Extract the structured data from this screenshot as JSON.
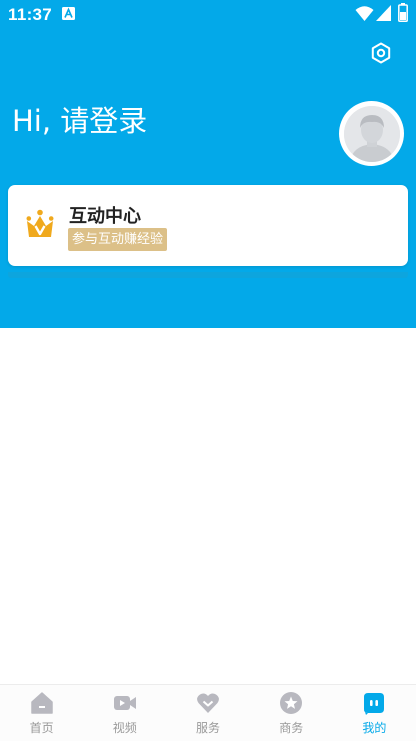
{
  "status_bar": {
    "time": "11:37",
    "icons": [
      "a-notification-icon",
      "wifi-icon",
      "signal-icon",
      "battery-icon"
    ]
  },
  "header": {
    "greeting": "Hi, 请登录",
    "settings_icon": "gear-icon",
    "avatar_icon": "default-avatar"
  },
  "card": {
    "title": "互动中心",
    "badge": "参与互动赚经验",
    "icon": "crown-icon"
  },
  "bottom_nav": {
    "items": [
      {
        "label": "首页",
        "icon": "home-icon",
        "active": false
      },
      {
        "label": "视频",
        "icon": "video-icon",
        "active": false
      },
      {
        "label": "服务",
        "icon": "heart-icon",
        "active": false
      },
      {
        "label": "商务",
        "icon": "star-icon",
        "active": false
      },
      {
        "label": "我的",
        "icon": "profile-icon",
        "active": true
      }
    ]
  },
  "colors": {
    "primary": "#03a9e9",
    "badge": "#dcc088",
    "crown": "#f0a91d",
    "nav_inactive": "#b8b8bf",
    "nav_active": "#03a9e9"
  }
}
